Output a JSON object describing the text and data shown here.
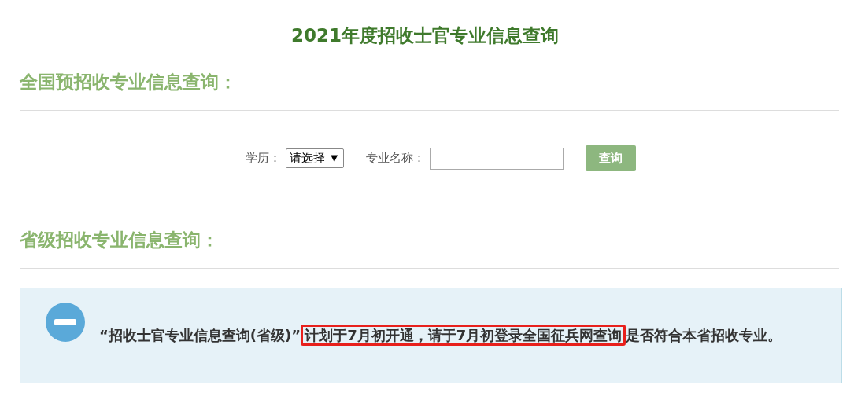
{
  "page_title": "2021年度招收士官专业信息查询",
  "sections": [
    {
      "heading": "全国预招收专业信息查询：",
      "form": {
        "education_label": "学历：",
        "education_select": "请选择 ▼",
        "major_label": "专业名称：",
        "button": "查询"
      }
    },
    {
      "heading": "省级招收专业信息查询："
    }
  ],
  "notice": {
    "parts": [
      {
        "text": "“招收士官专业信息查询(省级)”",
        "highlighted": false
      },
      {
        "text": "计划于7月初开通，请于7月初登录全国征兵网查询",
        "highlighted": true
      },
      {
        "text": "是否符合本省招收专业。",
        "highlighted": false
      }
    ]
  }
}
